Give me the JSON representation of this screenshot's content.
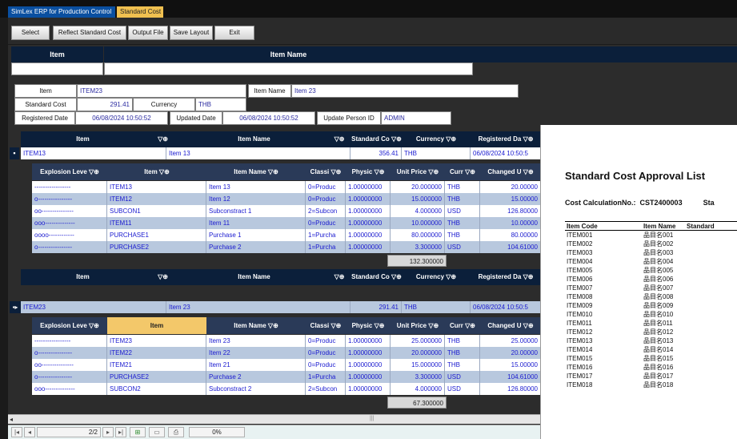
{
  "tabs": [
    {
      "label": "SimLex ERP for Production Control"
    },
    {
      "label": "Standard Cost"
    }
  ],
  "toolbar": {
    "select_label": "Select",
    "reflect_label": "Reflect Standard Cost",
    "output_label": "Output File",
    "save_layout_label": "Save Layout",
    "exit_label": "Exit"
  },
  "search_header": {
    "item": "Item",
    "item_name": "Item Name"
  },
  "form": {
    "item_label": "Item",
    "item_value": "ITEM23",
    "item_name_label": "Item Name",
    "item_name_value": "Item 23",
    "standard_cost_label": "Standard Cost",
    "standard_cost_value": "291.41",
    "currency_label": "Currency",
    "currency_value": "THB",
    "registered_date_label": "Registered Date",
    "registered_date_value": "06/08/2024 10:50:52",
    "updated_date_label": "Updated Date",
    "updated_date_value": "06/08/2024 10:50:52",
    "update_person_label": "Update Person ID",
    "update_person_value": "ADMIN"
  },
  "main_grid": {
    "columns": [
      "Item",
      "Item Name",
      "Standard Co",
      "Currency",
      "Registered Da"
    ],
    "filter_icon": "filter-pin-icon"
  },
  "sub_grid_columns": [
    "Explosion Leve",
    "Item",
    "Item Name",
    "Classi",
    "Physic",
    "Unit Price",
    "Curr",
    "Changed U"
  ],
  "group1": {
    "parent": {
      "item": "ITEM13",
      "item_name": "Item 13",
      "standard_cost": "356.41",
      "currency": "THB",
      "registered": "06/08/2024 10:50:5"
    },
    "rows": [
      {
        "level": "-----------------",
        "item": "ITEM13",
        "name": "Item 13",
        "cls": "0=Produc",
        "phys": "1.00000000",
        "price": "20.000000",
        "curr": "THB",
        "changed": "20.00000"
      },
      {
        "level": "o----------------",
        "item": "ITEM12",
        "name": "Item 12",
        "cls": "0=Produc",
        "phys": "1.00000000",
        "price": "15.000000",
        "curr": "THB",
        "changed": "15.00000"
      },
      {
        "level": "oo---------------",
        "item": "SUBCON1",
        "name": "Subconstract 1",
        "cls": "2=Subcon",
        "phys": "1.00000000",
        "price": "4.000000",
        "curr": "USD",
        "changed": "126.80000"
      },
      {
        "level": "ooo--------------",
        "item": "ITEM11",
        "name": "Item 11",
        "cls": "0=Produc",
        "phys": "1.00000000",
        "price": "10.000000",
        "curr": "THB",
        "changed": "10.00000"
      },
      {
        "level": "oooo------------",
        "item": "PURCHASE1",
        "name": "Purchase 1",
        "cls": "1=Purcha",
        "phys": "1.00000000",
        "price": "80.000000",
        "curr": "THB",
        "changed": "80.00000"
      },
      {
        "level": "o----------------",
        "item": "PURCHASE2",
        "name": "Purchase 2",
        "cls": "1=Purcha",
        "phys": "1.00000000",
        "price": "3.300000",
        "curr": "USD",
        "changed": "104.61000"
      }
    ],
    "total": "132.300000"
  },
  "group2": {
    "parent": {
      "item": "ITEM23",
      "item_name": "Item 23",
      "standard_cost": "291.41",
      "currency": "THB",
      "registered": "06/08/2024 10:50:5"
    },
    "rows": [
      {
        "level": "-----------------",
        "item": "ITEM23",
        "name": "Item 23",
        "cls": "0=Produc",
        "phys": "1.00000000",
        "price": "25.000000",
        "curr": "THB",
        "changed": "25.00000"
      },
      {
        "level": "o----------------",
        "item": "ITEM22",
        "name": "Item 22",
        "cls": "0=Produc",
        "phys": "1.00000000",
        "price": "20.000000",
        "curr": "THB",
        "changed": "20.00000"
      },
      {
        "level": "oo---------------",
        "item": "ITEM21",
        "name": "Item 21",
        "cls": "0=Produc",
        "phys": "1.00000000",
        "price": "15.000000",
        "curr": "THB",
        "changed": "15.00000"
      },
      {
        "level": "o----------------",
        "item": "PURCHASE2",
        "name": "Purchase 2",
        "cls": "1=Purcha",
        "phys": "1.00000000",
        "price": "3.300000",
        "curr": "USD",
        "changed": "104.61000"
      },
      {
        "level": "ooo--------------",
        "item": "SUBCON2",
        "name": "Subconstract 2",
        "cls": "2=Subcon",
        "phys": "1.00000000",
        "price": "4.000000",
        "curr": "USD",
        "changed": "126.80000"
      }
    ],
    "total": "67.300000"
  },
  "status_bar": {
    "page": "2/2",
    "progress": "0%"
  },
  "report": {
    "title": "Standard Cost Approval List",
    "calc_label": "Cost CalculationNo.:",
    "calc_value": "CST2400003",
    "calc_trailing": "Sta",
    "columns": [
      "Item Code",
      "Item Name",
      "Standard"
    ],
    "rows": [
      {
        "code": "ITEM001",
        "name": "品目名001"
      },
      {
        "code": "ITEM002",
        "name": "品目名002"
      },
      {
        "code": "ITEM003",
        "name": "品目名003"
      },
      {
        "code": "ITEM004",
        "name": "品目名004"
      },
      {
        "code": "ITEM005",
        "name": "品目名005"
      },
      {
        "code": "ITEM006",
        "name": "品目名006"
      },
      {
        "code": "ITEM007",
        "name": "品目名007"
      },
      {
        "code": "ITEM008",
        "name": "品目名008"
      },
      {
        "code": "ITEM009",
        "name": "品目名009"
      },
      {
        "code": "ITEM010",
        "name": "品目名010"
      },
      {
        "code": "ITEM011",
        "name": "品目名011"
      },
      {
        "code": "ITEM012",
        "name": "品目名012"
      },
      {
        "code": "ITEM013",
        "name": "品目名013"
      },
      {
        "code": "ITEM014",
        "name": "品目名014"
      },
      {
        "code": "ITEM015",
        "name": "品目名015"
      },
      {
        "code": "ITEM016",
        "name": "品目名016"
      },
      {
        "code": "ITEM017",
        "name": "品目名017"
      },
      {
        "code": "ITEM018",
        "name": "品目名018"
      }
    ]
  }
}
